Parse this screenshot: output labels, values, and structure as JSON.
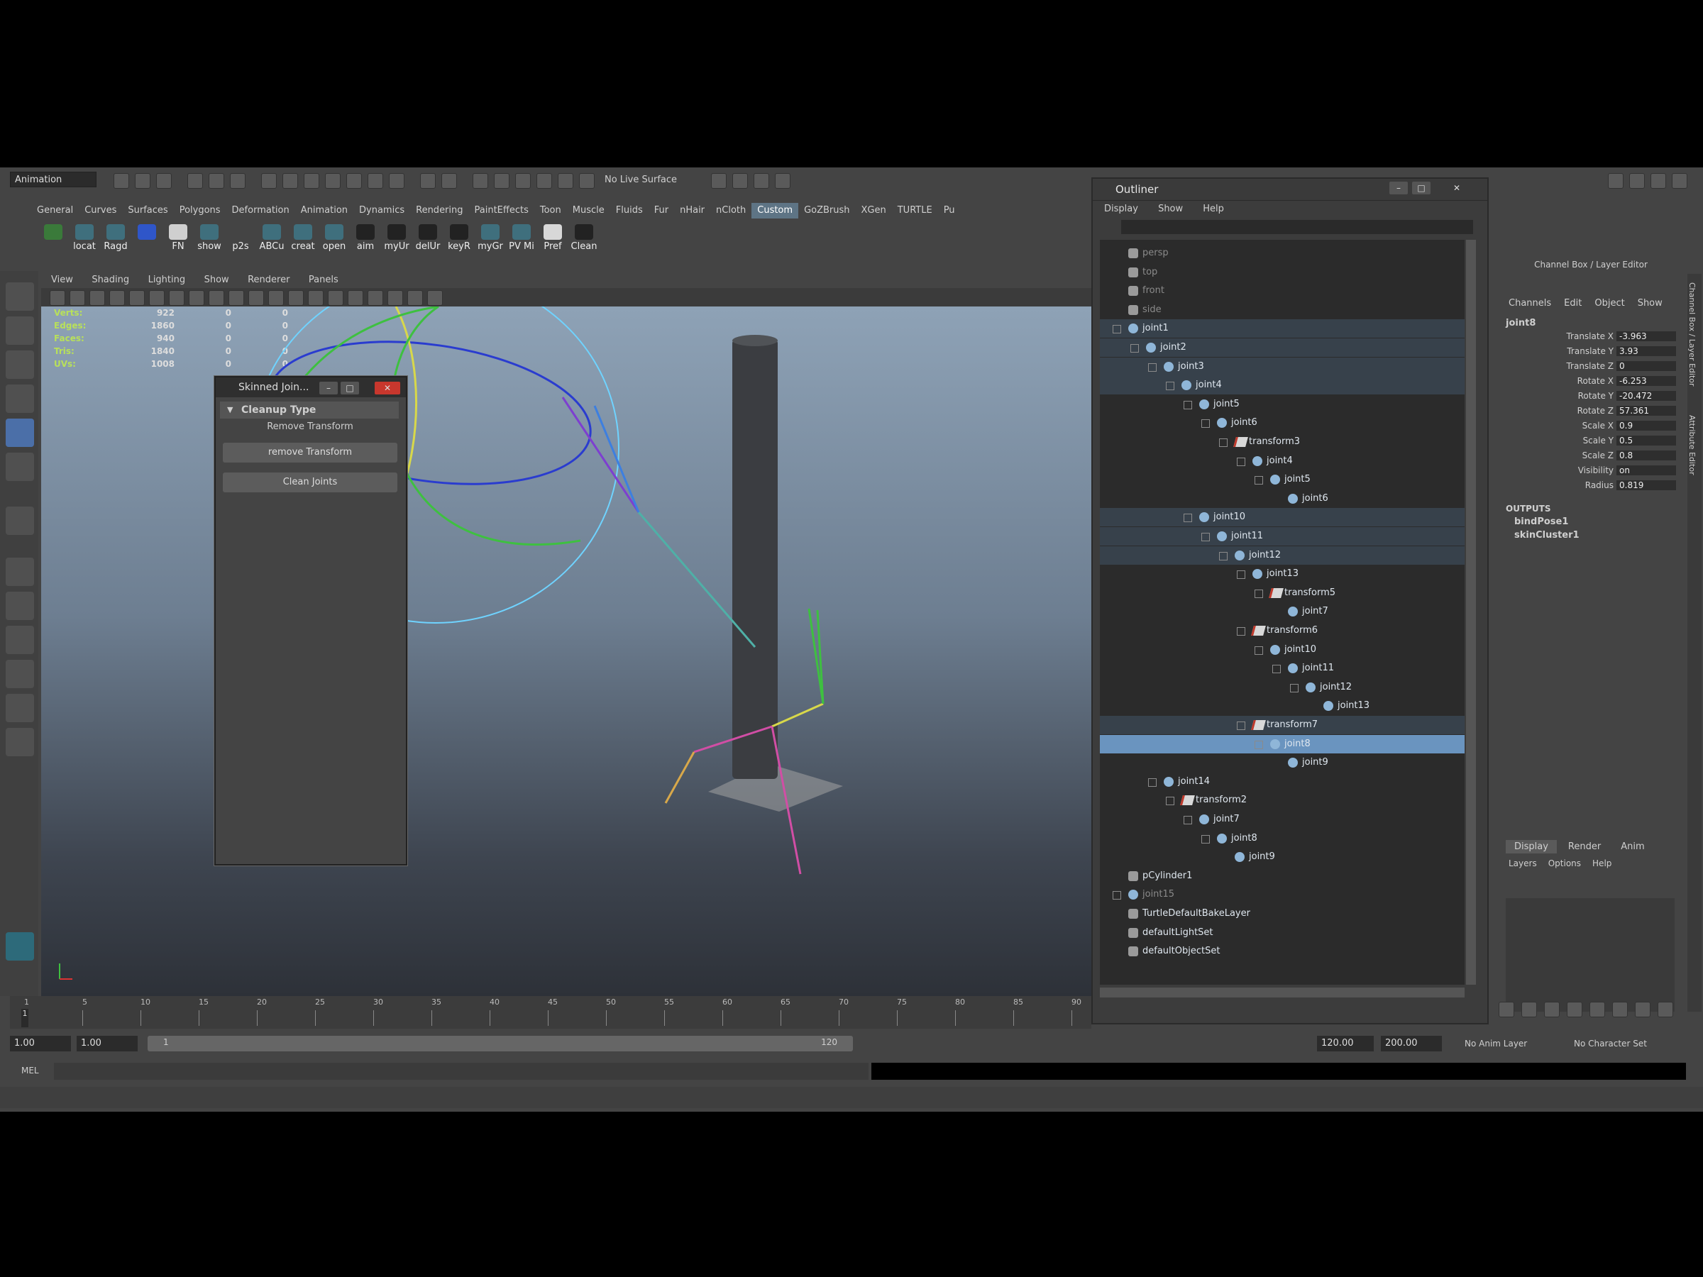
{
  "status_line": {
    "menu_set": "Animation",
    "live_surface": "No Live Surface"
  },
  "shelf_tabs": [
    "General",
    "Curves",
    "Surfaces",
    "Polygons",
    "Deformation",
    "Animation",
    "Dynamics",
    "Rendering",
    "PaintEffects",
    "Toon",
    "Muscle",
    "Fluids",
    "Fur",
    "nHair",
    "nCloth",
    "Custom",
    "GoZBrush",
    "XGen",
    "TURTLE",
    "Pu"
  ],
  "shelf_active": "Custom",
  "shelf_buttons": [
    "locat",
    "Ragd",
    "",
    "FN",
    "show",
    "p2s",
    "ABCu",
    "creat",
    "open",
    "aim",
    "myUr",
    "delUr",
    "keyR",
    "myGr",
    "PV Mi",
    "Pref",
    "Clean"
  ],
  "panel_menu": [
    "View",
    "Shading",
    "Lighting",
    "Show",
    "Renderer",
    "Panels"
  ],
  "hud": {
    "rows": [
      {
        "label": "Verts:",
        "a": "922",
        "b": "0",
        "c": "0"
      },
      {
        "label": "Edges:",
        "a": "1860",
        "b": "0",
        "c": "0"
      },
      {
        "label": "Faces:",
        "a": "940",
        "b": "0",
        "c": "0"
      },
      {
        "label": "Tris:",
        "a": "1840",
        "b": "0",
        "c": "0"
      },
      {
        "label": "UVs:",
        "a": "1008",
        "b": "0",
        "c": "0"
      }
    ]
  },
  "skinned_window": {
    "title": "Skinned Join...",
    "section": "Cleanup Type",
    "static_label": "Remove Transform",
    "btn_remove": "remove Transform",
    "btn_clean": "Clean Joints"
  },
  "outliner": {
    "title": "Outliner",
    "menu": [
      "Display",
      "Show",
      "Help"
    ],
    "rows": [
      {
        "label": "persp",
        "type": "cam",
        "depth": 0,
        "dim": true
      },
      {
        "label": "top",
        "type": "cam",
        "depth": 0,
        "dim": true
      },
      {
        "label": "front",
        "type": "cam",
        "depth": 0,
        "dim": true
      },
      {
        "label": "side",
        "type": "cam",
        "depth": 0,
        "dim": true
      },
      {
        "label": "joint1",
        "type": "jnt",
        "depth": 0,
        "band": true,
        "box": true
      },
      {
        "label": "joint2",
        "type": "jnt",
        "depth": 1,
        "band": true,
        "box": true
      },
      {
        "label": "joint3",
        "type": "jnt",
        "depth": 2,
        "band": true,
        "box": true
      },
      {
        "label": "joint4",
        "type": "jnt",
        "depth": 3,
        "band": true,
        "box": true
      },
      {
        "label": "joint5",
        "type": "jnt",
        "depth": 4,
        "box": true
      },
      {
        "label": "joint6",
        "type": "jnt",
        "depth": 5,
        "box": true
      },
      {
        "label": "transform3",
        "type": "xf",
        "depth": 6,
        "box": true
      },
      {
        "label": "joint4",
        "type": "jnt",
        "depth": 7,
        "box": true
      },
      {
        "label": "joint5",
        "type": "jnt",
        "depth": 8,
        "box": true
      },
      {
        "label": "joint6",
        "type": "jnt",
        "depth": 9
      },
      {
        "label": "joint10",
        "type": "jnt",
        "depth": 4,
        "band": true,
        "box": true
      },
      {
        "label": "joint11",
        "type": "jnt",
        "depth": 5,
        "band": true,
        "box": true
      },
      {
        "label": "joint12",
        "type": "jnt",
        "depth": 6,
        "band": true,
        "box": true
      },
      {
        "label": "joint13",
        "type": "jnt",
        "depth": 7,
        "box": true
      },
      {
        "label": "transform5",
        "type": "xf",
        "depth": 8,
        "box": true
      },
      {
        "label": "joint7",
        "type": "jnt",
        "depth": 9
      },
      {
        "label": "transform6",
        "type": "xf",
        "depth": 7,
        "box": true
      },
      {
        "label": "joint10",
        "type": "jnt",
        "depth": 8,
        "box": true
      },
      {
        "label": "joint11",
        "type": "jnt",
        "depth": 9,
        "box": true
      },
      {
        "label": "joint12",
        "type": "jnt",
        "depth": 10,
        "box": true
      },
      {
        "label": "joint13",
        "type": "jnt",
        "depth": 11
      },
      {
        "label": "transform7",
        "type": "xf",
        "depth": 7,
        "band": true,
        "box": true
      },
      {
        "label": "joint8",
        "type": "jnt",
        "depth": 8,
        "sel": true,
        "box": true
      },
      {
        "label": "joint9",
        "type": "jnt",
        "depth": 9
      },
      {
        "label": "joint14",
        "type": "jnt",
        "depth": 2,
        "box": true
      },
      {
        "label": "transform2",
        "type": "xf",
        "depth": 3,
        "box": true
      },
      {
        "label": "joint7",
        "type": "jnt",
        "depth": 4,
        "box": true
      },
      {
        "label": "joint8",
        "type": "jnt",
        "depth": 5,
        "box": true
      },
      {
        "label": "joint9",
        "type": "jnt",
        "depth": 6
      },
      {
        "label": "pCylinder1",
        "type": "mesh",
        "depth": 0
      },
      {
        "label": "joint15",
        "type": "jnt",
        "depth": 0,
        "dim": true,
        "plus": true
      },
      {
        "label": "TurtleDefaultBakeLayer",
        "type": "cam",
        "depth": 0
      },
      {
        "label": "defaultLightSet",
        "type": "cam",
        "depth": 0
      },
      {
        "label": "defaultObjectSet",
        "type": "cam",
        "depth": 0
      }
    ]
  },
  "channel_box": {
    "title": "Channel Box / Layer Editor",
    "menu": [
      "Channels",
      "Edit",
      "Object",
      "Show"
    ],
    "object": "joint8",
    "channels": [
      {
        "name": "Translate X",
        "value": "-3.963"
      },
      {
        "name": "Translate Y",
        "value": "3.93"
      },
      {
        "name": "Translate Z",
        "value": "0"
      },
      {
        "name": "Rotate X",
        "value": "-6.253"
      },
      {
        "name": "Rotate Y",
        "value": "-20.472"
      },
      {
        "name": "Rotate Z",
        "value": "57.361"
      },
      {
        "name": "Scale X",
        "value": "0.9"
      },
      {
        "name": "Scale Y",
        "value": "0.5"
      },
      {
        "name": "Scale Z",
        "value": "0.8"
      },
      {
        "name": "Visibility",
        "value": "on"
      },
      {
        "name": "Radius",
        "value": "0.819"
      }
    ],
    "outputs_label": "OUTPUTS",
    "outputs": [
      "bindPose1",
      "skinCluster1"
    ],
    "layer_tabs": [
      "Display",
      "Render",
      "Anim"
    ],
    "layer_menu": [
      "Layers",
      "Options",
      "Help"
    ],
    "side_tabs": [
      "Channel Box / Layer Editor",
      "Attribute Editor"
    ]
  },
  "timeline": {
    "ticks": [
      "1",
      "5",
      "10",
      "15",
      "20",
      "25",
      "30",
      "35",
      "40",
      "45",
      "50",
      "55",
      "60",
      "65",
      "70",
      "75",
      "80",
      "85",
      "90"
    ],
    "current": "1"
  },
  "range_slider": {
    "start": "1.00",
    "start2": "1.00",
    "slider_start": "1",
    "slider_end": "120",
    "end": "120.00",
    "end2": "200.00",
    "anim_layer": "No Anim Layer",
    "char_set": "No Character Set"
  },
  "cmd_line": {
    "label": "MEL"
  }
}
